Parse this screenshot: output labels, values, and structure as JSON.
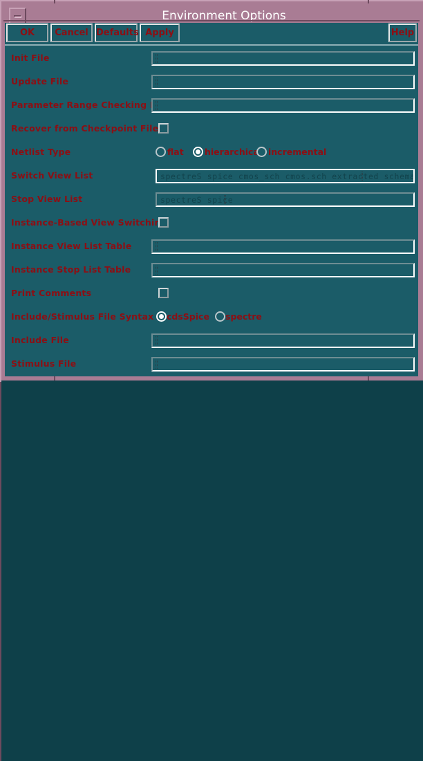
{
  "window": {
    "title": "Environment Options",
    "minimize_icon": "minimize-icon",
    "colors": {
      "title_bar": "#a97c94",
      "frame": "#a97c94",
      "client": "#1b5c68",
      "label_text": "#8c0f14",
      "title_text": "#ffffff",
      "field_text": "#12434c"
    }
  },
  "action_bar": {
    "ok": "OK",
    "cancel": "Cancel",
    "defaults": "Defaults",
    "apply": "Apply",
    "help": "Help"
  },
  "form": {
    "rows": [
      {
        "label": "Init File",
        "type": "text",
        "value": ""
      },
      {
        "label": "Update File",
        "type": "text",
        "value": ""
      },
      {
        "label": "Parameter Range Checking File",
        "type": "text",
        "value": ""
      },
      {
        "label": "Recover from Checkpoint File",
        "type": "checkbox",
        "checked": false
      },
      {
        "label": "Netlist Type",
        "type": "radio"
      },
      {
        "label": "Switch View List",
        "type": "text",
        "value": "spectreS spice cmos_sch cmos.sch extracted schematic v"
      },
      {
        "label": "Stop View List",
        "type": "text",
        "value": "spectreS spice"
      },
      {
        "label": "Instance-Based View Switching",
        "type": "checkbox",
        "checked": false
      },
      {
        "label": "Instance View List Table",
        "type": "text",
        "value": ""
      },
      {
        "label": "Instance Stop List Table",
        "type": "text",
        "value": ""
      },
      {
        "label": "Print Comments",
        "type": "checkbox",
        "checked": false
      },
      {
        "label": "Include/Stimulus File Syntax",
        "type": "radio"
      },
      {
        "label": "Include File",
        "type": "text",
        "value": ""
      },
      {
        "label": "Stimulus File",
        "type": "text",
        "value": ""
      }
    ],
    "netlist_type": {
      "options": [
        "flat",
        "hierarchical",
        "incremental"
      ],
      "selected": "hierarchical"
    },
    "include_stimulus_syntax": {
      "options": [
        "cdsSpice",
        "spectre"
      ],
      "selected": "cdsSpice"
    }
  }
}
